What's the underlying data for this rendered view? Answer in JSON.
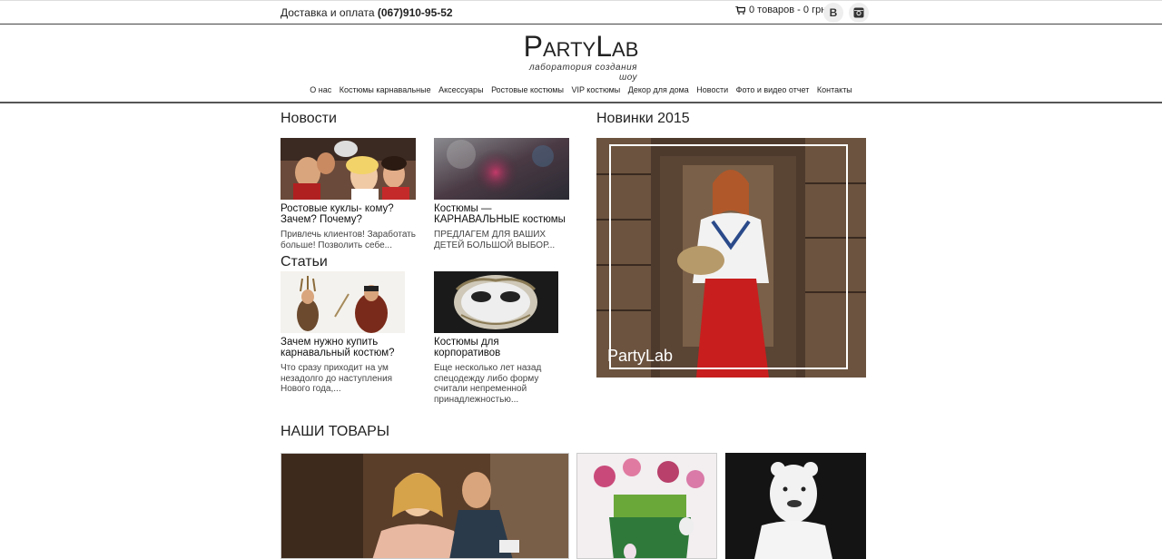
{
  "topbar": {
    "delivery_label": "Доставка и оплата",
    "phone": "(067)910-95-52",
    "cart_text": "0 товаров - 0 грн.",
    "social_vk": "В",
    "social_ig": "◙"
  },
  "logo": {
    "name_p": "P",
    "name_arty": "ARTY",
    "name_l": "L",
    "name_ab": "AB",
    "tagline": "лаборатория создания шоу"
  },
  "nav": {
    "items": [
      "О нас",
      "Костюмы карнавальные",
      "Аксессуары",
      "Ростовые костюмы",
      "VIP костюмы",
      "Декор для дома",
      "Новости",
      "Фото и видео отчет",
      "Контакты"
    ]
  },
  "sections": {
    "news_title": "Новости",
    "new2015_title": "Новинки 2015",
    "articles_title": "Статьи",
    "products_title": "НАШИ ТОВАРЫ"
  },
  "news": [
    {
      "title": "Ростовые куклы- кому? Зачем? Почему?",
      "desc": "Привлечь клиентов! Заработать больше! Позволить себе..."
    },
    {
      "title": "Костюмы — КАРНАВАЛЬНЫЕ костюмы",
      "desc": "ПРЕДЛАГЕМ ДЛЯ ВАШИХ ДЕТЕЙ БОЛЬШОЙ ВЫБОР..."
    }
  ],
  "articles": [
    {
      "title": "Зачем нужно купить карнавальный костюм?",
      "desc": "Что сразу приходит на ум незадолго до наступления Нового года,..."
    },
    {
      "title": "Костюмы для корпоративов",
      "desc": "Еще несколько лет назад спецодежду либо форму считали непременной принадлежностью..."
    }
  ],
  "feature": {
    "watermark": "PartyLab"
  },
  "colors": {
    "text": "#222222",
    "divider": "#555555"
  }
}
